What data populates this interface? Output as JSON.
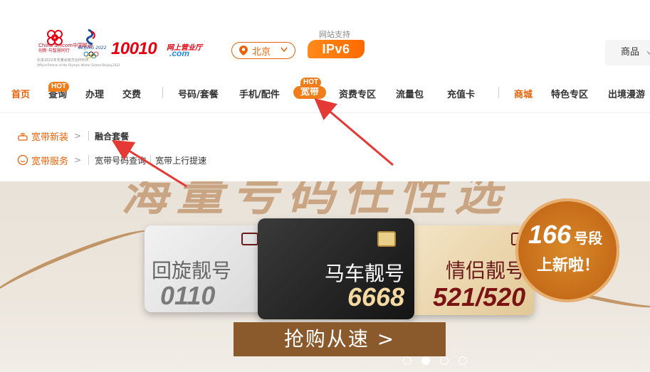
{
  "header": {
    "cu_logo_text": "China unicom中国联通",
    "cu_logo_sub": "创新·与智慧同行",
    "cu_partner_line1": "北京2022年冬奥会官方合作伙伴",
    "cu_partner_line2": "Official Partner of the Olympic Winter Games Beijing 2022",
    "bj_logo_text": "BEIJING 2022",
    "site_number": "10010",
    "site_sub": "网上营业厅",
    "site_domain": ".com",
    "city": "北京",
    "ipv6_caption": "网站支持",
    "ipv6_label": "IPv6",
    "mall_label": "商品"
  },
  "nav": {
    "items": [
      {
        "label": "首页"
      },
      {
        "label": "查询",
        "badge": "HOT"
      },
      {
        "label": "办理"
      },
      {
        "label": "交费"
      },
      {
        "label": "号码/套餐"
      },
      {
        "label": "手机/配件"
      },
      {
        "label": "宽带",
        "badge": "HOT"
      },
      {
        "label": "资费专区"
      },
      {
        "label": "流量包"
      },
      {
        "label": "充值卡"
      },
      {
        "label": "商城"
      },
      {
        "label": "特色专区"
      },
      {
        "label": "出境漫游"
      }
    ]
  },
  "dropdown": {
    "rows": [
      {
        "category": "宽带新装",
        "arrow": ">",
        "links": [
          "融合套餐"
        ]
      },
      {
        "category": "宽带服务",
        "arrow": ">",
        "links": [
          "宽带号码查询",
          "宽带上行提速"
        ]
      }
    ]
  },
  "banner": {
    "headline": "海量号码任性选",
    "cards": [
      {
        "name": "回旋靓号",
        "number": "0110"
      },
      {
        "name": "马车靓号",
        "number": "6668"
      },
      {
        "name": "情侣靓号",
        "number": "521/520"
      }
    ],
    "medal_number": "166",
    "medal_unit": "号段",
    "medal_line2": "上新啦！",
    "buy_button": "抢购从速 >",
    "dots_active_index": 1
  },
  "colors": {
    "accent": "#e8630a",
    "nav_active_bg": "#f07d1a",
    "unicom_red": "#e60012"
  }
}
